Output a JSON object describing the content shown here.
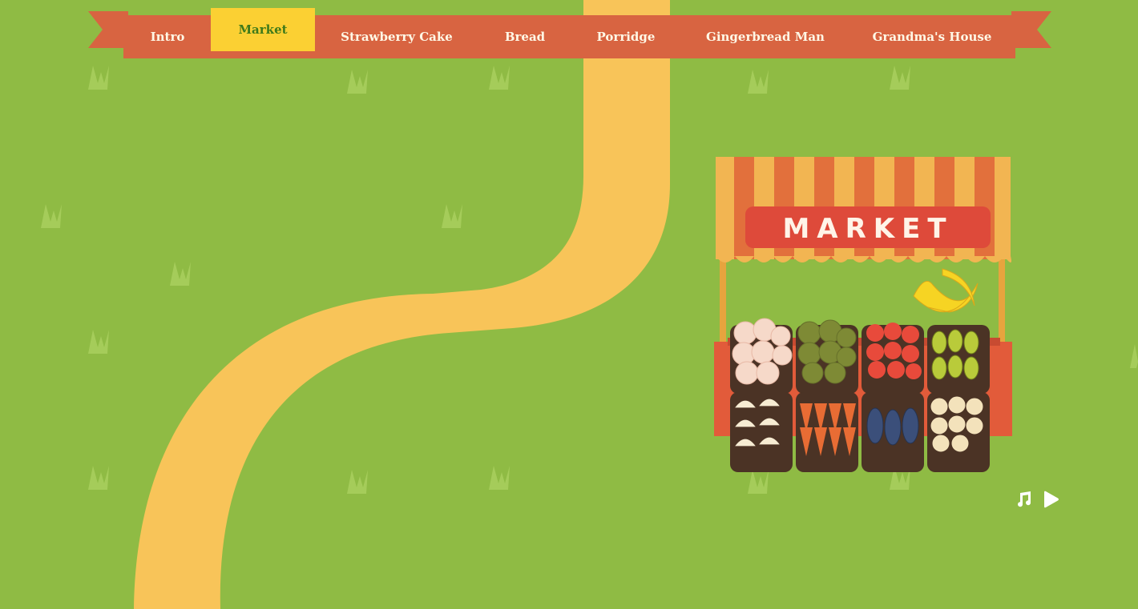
{
  "nav": {
    "items": [
      {
        "label": "Intro"
      },
      {
        "label": "Market"
      },
      {
        "label": "Strawberry Cake"
      },
      {
        "label": "Bread"
      },
      {
        "label": "Porridge"
      },
      {
        "label": "Gingerbread Man"
      },
      {
        "label": "Grandma's House"
      }
    ],
    "active_index": 1
  },
  "stall": {
    "sign_text": "MARKET"
  },
  "music": {
    "note_icon": "music-note-icon",
    "play_icon": "play-icon"
  },
  "colors": {
    "grass": "#8fbb44",
    "path": "#f8c459",
    "ribbon": "#d86441",
    "active_tab": "#fbd033",
    "sign": "#de4a3a"
  }
}
